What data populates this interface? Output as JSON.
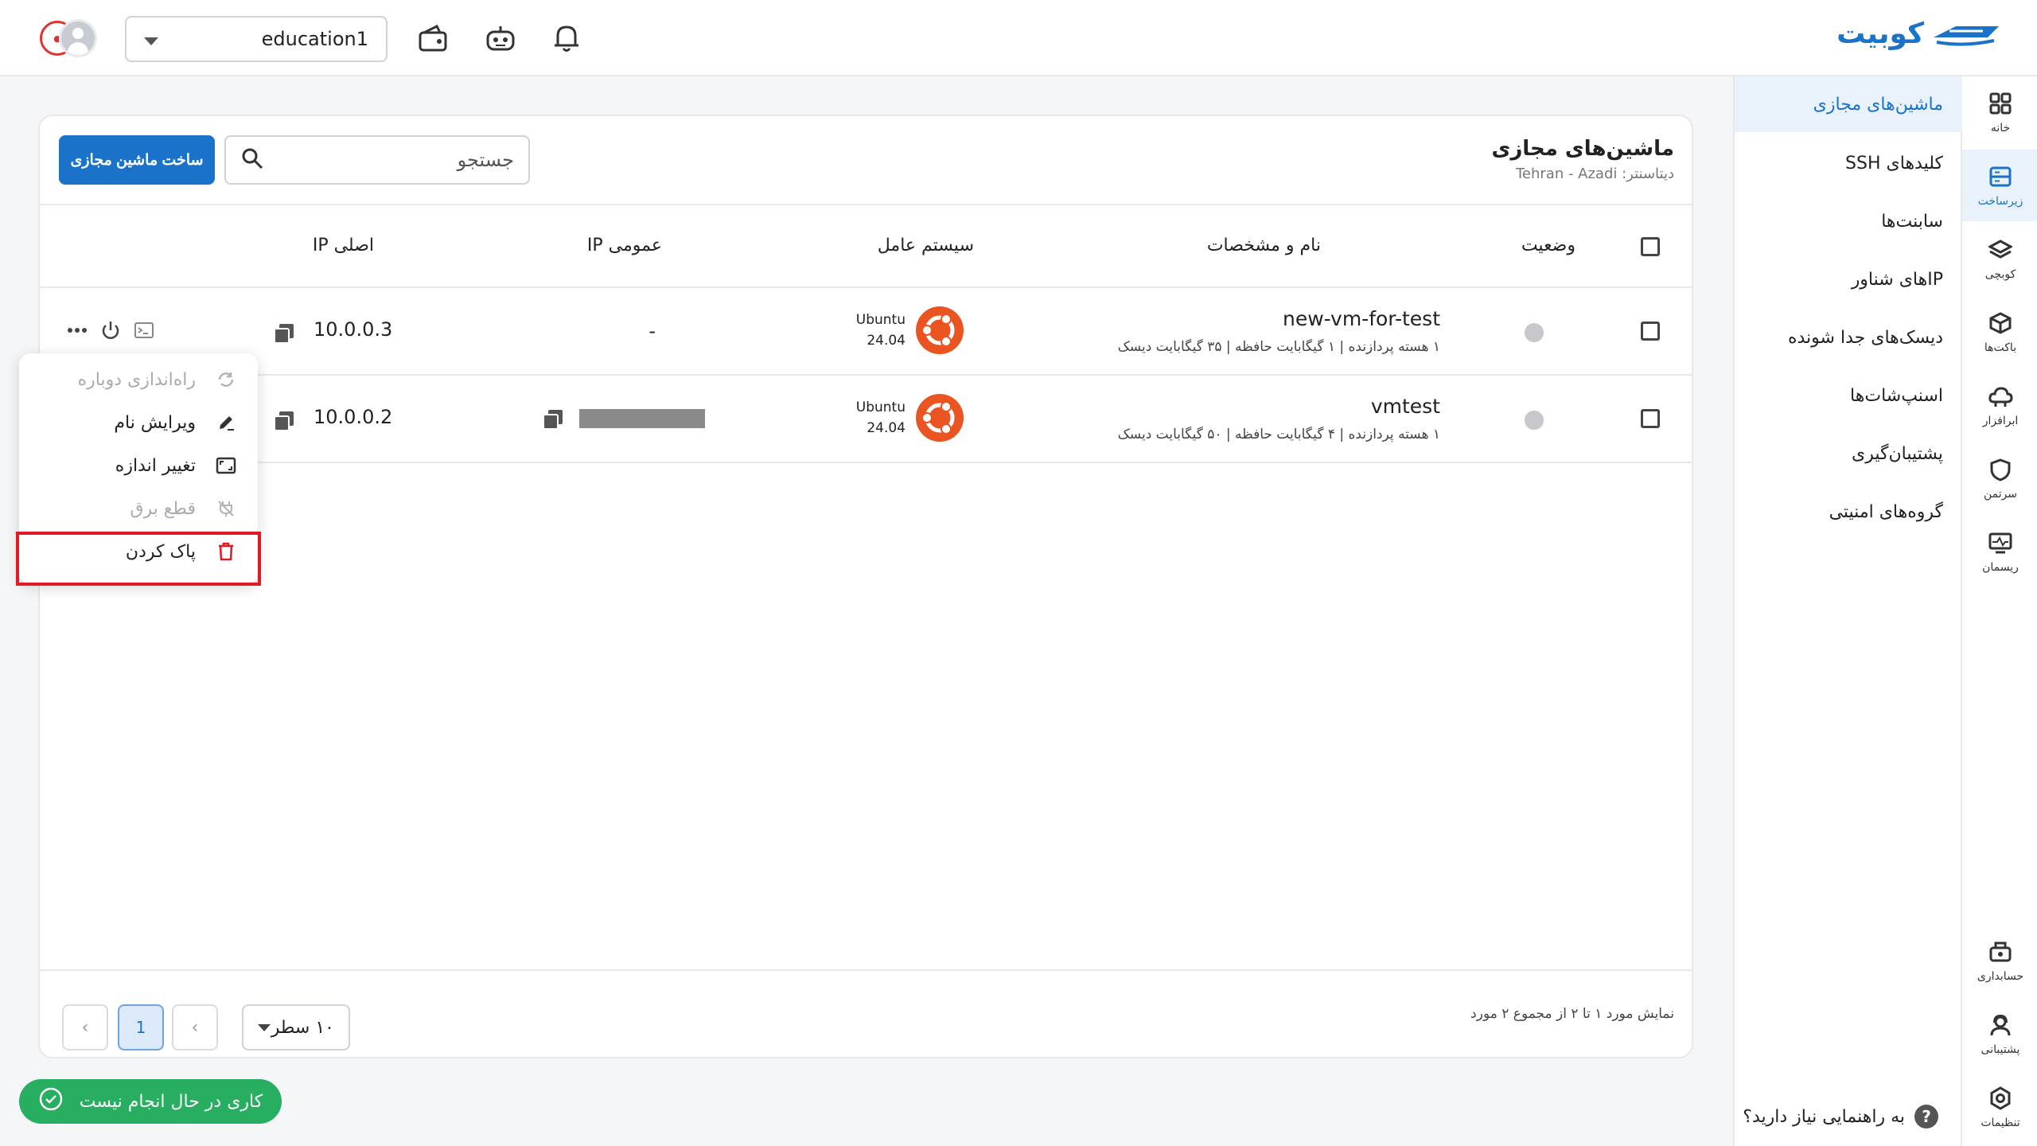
{
  "app": {
    "logo_text": "کوبیت",
    "brand_color": "#1a73c8"
  },
  "topbar": {
    "workspace": "education1",
    "icons": [
      "wallet-icon",
      "robot-icon",
      "bell-icon"
    ]
  },
  "rail": {
    "items": [
      {
        "label": "خانه",
        "icon": "grid-icon"
      },
      {
        "label": "زیرساخت",
        "icon": "server-icon",
        "active": true
      },
      {
        "label": "کوبچی",
        "icon": "layers-icon"
      },
      {
        "label": "باکت‌ها",
        "icon": "cube-icon"
      },
      {
        "label": "ابرافزار",
        "icon": "cloud-icon"
      },
      {
        "label": "سرتمن",
        "icon": "shield-icon"
      },
      {
        "label": "ریسمان",
        "icon": "monitor-icon"
      },
      {
        "label": "حسابداری",
        "icon": "accounting-icon"
      },
      {
        "label": "پشتیبانی",
        "icon": "support-icon"
      },
      {
        "label": "تنظیمات",
        "icon": "gear-icon"
      }
    ]
  },
  "subnav": {
    "items": [
      {
        "label": "ماشین‌های مجازی",
        "active": true
      },
      {
        "label": "کلیدهای SSH"
      },
      {
        "label": "سابنت‌ها"
      },
      {
        "label": "IPهای شناور"
      },
      {
        "label": "دیسک‌های جدا شونده"
      },
      {
        "label": "اسنپ‌شات‌ها"
      },
      {
        "label": "پشتیبان‌گیری"
      },
      {
        "label": "گروه‌های امنیتی"
      }
    ],
    "help": "به راهنمایی نیاز دارید؟"
  },
  "main": {
    "title": "ماشین‌های مجازی",
    "datacenter": "دیتاسنتر: Tehran - Azadi",
    "search_placeholder": "جستجو",
    "create_button": "ساخت ماشین مجازی",
    "columns": {
      "status": "وضعیت",
      "name": "نام و مشخصات",
      "os": "سیستم عامل",
      "public_ip": "IP عمومی",
      "private_ip": "IP اصلی"
    },
    "rows": [
      {
        "name": "new-vm-for-test",
        "specs": "۱ هسته پردازنده | ۱ گیگابایت حافظه | ۳۵ گیگابایت دیسک",
        "os_name": "Ubuntu",
        "os_version": "24.04",
        "public_ip": "-",
        "private_ip": "10.0.0.3"
      },
      {
        "name": "vmtest",
        "specs": "۱ هسته پردازنده | ۴ گیگابایت حافظه | ۵۰ گیگابایت دیسک",
        "os_name": "Ubuntu",
        "os_version": "24.04",
        "public_ip": "",
        "private_ip": "10.0.0.2"
      }
    ],
    "context_menu": [
      {
        "label": "راه‌اندازی دوباره",
        "icon": "restart-icon",
        "disabled": true
      },
      {
        "label": "ویرایش نام",
        "icon": "pencil-icon",
        "disabled": false
      },
      {
        "label": "تغییر اندازه",
        "icon": "resize-icon",
        "disabled": false
      },
      {
        "label": "قطع برق",
        "icon": "power-off-icon",
        "disabled": true
      },
      {
        "label": "پاک کردن",
        "icon": "trash-icon",
        "disabled": false,
        "danger": true
      }
    ],
    "footer": {
      "info": "نمایش مورد ۱ تا ۲ از مجموع ۲ مورد",
      "rows_per_page": "۱۰ سطر",
      "current_page": "1"
    }
  },
  "toast": {
    "text": "کاری در حال انجام نیست",
    "color": "#27ae60"
  }
}
